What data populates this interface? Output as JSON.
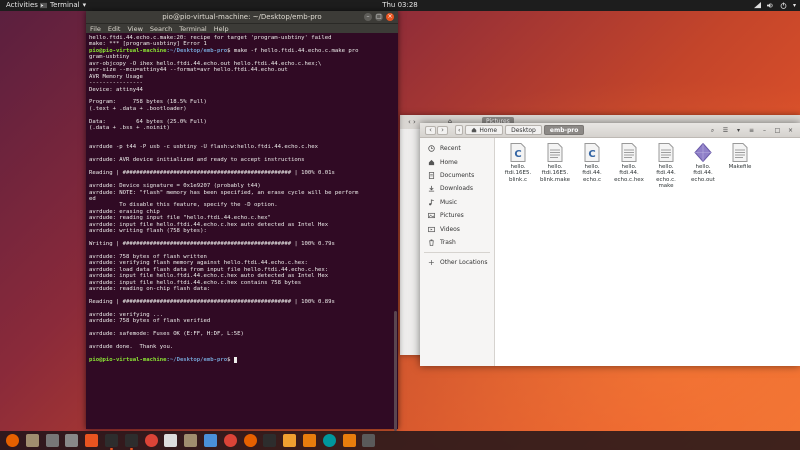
{
  "topbar": {
    "activities": "Activities",
    "app_menu": "Terminal",
    "clock": "Thu 03:28"
  },
  "terminal": {
    "title": "pio@pio-virtual-machine: ~/Desktop/emb-pro",
    "menu": [
      "File",
      "Edit",
      "View",
      "Search",
      "Terminal",
      "Help"
    ],
    "lines": [
      "hello.ftdi.44.echo.c.make:20: recipe for target 'program-usbtiny' failed",
      "make: *** [program-usbtiny] Error 1",
      "__PROMPT__ make -f hello.ftdi.44.echo.c.make pro",
      "gram-usbtiny",
      "avr-objcopy -O ihex hello.ftdi.44.echo.out hello.ftdi.44.echo.c.hex;\\",
      "avr-size --mcu=attiny44 --format=avr hello.ftdi.44.echo.out",
      "AVR Memory Usage",
      "----------------",
      "Device: attiny44",
      "",
      "Program:     758 bytes (18.5% Full)",
      "(.text + .data + .bootloader)",
      "",
      "Data:         64 bytes (25.0% Full)",
      "(.data + .bss + .noinit)",
      "",
      "",
      "avrdude -p t44 -P usb -c usbtiny -U flash:w:hello.ftdi.44.echo.c.hex",
      "",
      "avrdude: AVR device initialized and ready to accept instructions",
      "",
      "Reading | ################################################## | 100% 0.01s",
      "",
      "avrdude: Device signature = 0x1e9207 (probably t44)",
      "avrdude: NOTE: \"flash\" memory has been specified, an erase cycle will be perform",
      "ed",
      "         To disable this feature, specify the -D option.",
      "avrdude: erasing chip",
      "avrdude: reading input file \"hello.ftdi.44.echo.c.hex\"",
      "avrdude: input file hello.ftdi.44.echo.c.hex auto detected as Intel Hex",
      "avrdude: writing flash (758 bytes):",
      "",
      "Writing | ################################################## | 100% 0.79s",
      "",
      "avrdude: 758 bytes of flash written",
      "avrdude: verifying flash memory against hello.ftdi.44.echo.c.hex:",
      "avrdude: load data flash data from input file hello.ftdi.44.echo.c.hex:",
      "avrdude: input file hello.ftdi.44.echo.c.hex auto detected as Intel Hex",
      "avrdude: input file hello.ftdi.44.echo.c.hex contains 758 bytes",
      "avrdude: reading on-chip flash data:",
      "",
      "Reading | ################################################## | 100% 0.89s",
      "",
      "avrdude: verifying ...",
      "avrdude: 758 bytes of flash verified",
      "",
      "avrdude: safemode: Fuses OK (E:FF, H:DF, L:5E)",
      "",
      "avrdude done.  Thank you.",
      "",
      "__PROMPT_END__"
    ],
    "prompt_user": "pio@pio-virtual-machine",
    "prompt_path": ":~/Desktop/emb-pro",
    "prompt_symbol": "$"
  },
  "files_back": {
    "crumb": "Pictures"
  },
  "files": {
    "crumbs": [
      "Home",
      "Desktop",
      "emb-pro"
    ],
    "sidebar": [
      {
        "label": "Recent",
        "icon": "clock-icon"
      },
      {
        "label": "Home",
        "icon": "home-icon"
      },
      {
        "label": "Documents",
        "icon": "documents-icon"
      },
      {
        "label": "Downloads",
        "icon": "downloads-icon"
      },
      {
        "label": "Music",
        "icon": "music-icon"
      },
      {
        "label": "Pictures",
        "icon": "pictures-icon"
      },
      {
        "label": "Videos",
        "icon": "videos-icon"
      },
      {
        "label": "Trash",
        "icon": "trash-icon"
      }
    ],
    "other_locations": "Other Locations",
    "items": [
      {
        "name": "hello.\nftdi.16E5.\nblink.c",
        "type": "c"
      },
      {
        "name": "hello.\nftdi.16E5.\nblink.make",
        "type": "text"
      },
      {
        "name": "hello.\nftdi.44.\necho.c",
        "type": "c"
      },
      {
        "name": "hello.\nftdi.44.\necho.c.hex",
        "type": "text"
      },
      {
        "name": "hello.\nftdi.44.\necho.c.\nmake",
        "type": "text"
      },
      {
        "name": "hello.\nftdi.44.\necho.out",
        "type": "exec"
      },
      {
        "name": "Makefile",
        "type": "text"
      }
    ]
  },
  "dock": {
    "icons": [
      "firefox-icon",
      "files-icon",
      "software-icon",
      "settings-icon",
      "software-center-icon",
      "terminal-icon",
      "terminal-icon",
      "chrome-icon",
      "text-editor-icon",
      "files-icon",
      "image-viewer-icon",
      "chrome-icon",
      "firefox-icon",
      "terminal-icon",
      "video-icon",
      "blender-icon",
      "arduino-icon",
      "blender-icon",
      "system-icon"
    ]
  }
}
